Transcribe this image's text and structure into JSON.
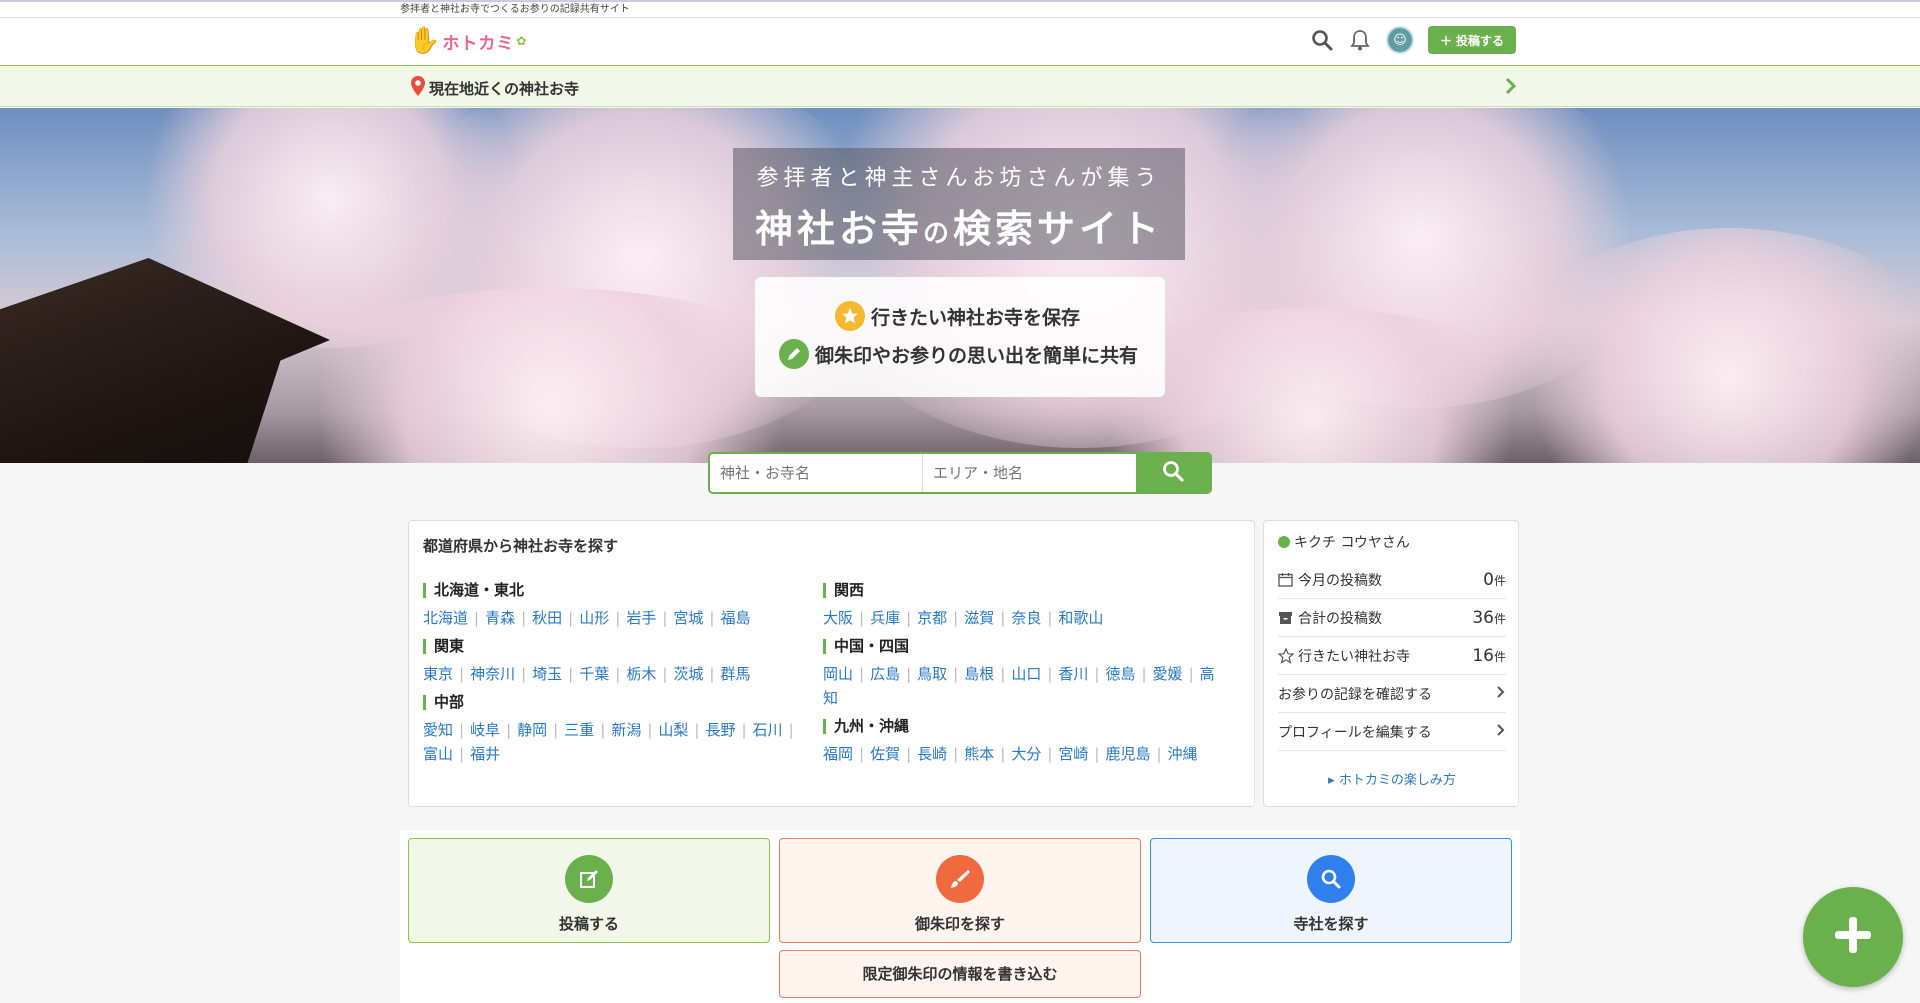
{
  "site": {
    "tagline_strip": "参拝者と神社お寺でつくるお参りの記録共有サイト",
    "logo_text": "ホトカミ"
  },
  "header": {
    "post_label": "投稿する"
  },
  "nearby": {
    "label": "現在地近くの神社お寺"
  },
  "hero": {
    "subtitle": "参拝者と神主さんお坊さんが集う",
    "title_a": "神社お寺",
    "title_no": "の",
    "title_b": "検索サイト",
    "feature1": "行きたい神社お寺を保存",
    "feature2": "御朱印やお参りの思い出を簡単に共有"
  },
  "search": {
    "name_placeholder": "神社・お寺名",
    "area_placeholder": "エリア・地名"
  },
  "prefectures": {
    "title": "都道府県から神社お寺を探す",
    "regions": [
      {
        "name": "北海道・東北",
        "items": [
          "北海道",
          "青森",
          "秋田",
          "山形",
          "岩手",
          "宮城",
          "福島"
        ]
      },
      {
        "name": "関東",
        "items": [
          "東京",
          "神奈川",
          "埼玉",
          "千葉",
          "栃木",
          "茨城",
          "群馬"
        ]
      },
      {
        "name": "中部",
        "items": [
          "愛知",
          "岐阜",
          "静岡",
          "三重",
          "新潟",
          "山梨",
          "長野",
          "石川",
          "富山",
          "福井"
        ]
      },
      {
        "name": "関西",
        "items": [
          "大阪",
          "兵庫",
          "京都",
          "滋賀",
          "奈良",
          "和歌山"
        ]
      },
      {
        "name": "中国・四国",
        "items": [
          "岡山",
          "広島",
          "鳥取",
          "島根",
          "山口",
          "香川",
          "徳島",
          "愛媛",
          "高知"
        ]
      },
      {
        "name": "九州・沖縄",
        "items": [
          "福岡",
          "佐賀",
          "長崎",
          "熊本",
          "大分",
          "宮崎",
          "鹿児島",
          "沖縄"
        ]
      }
    ]
  },
  "user": {
    "name": "キクチ コウヤさん",
    "month_posts_label": "今月の投稿数",
    "month_posts_value": "0",
    "total_posts_label": "合計の投稿数",
    "total_posts_value": "36",
    "wish_label": "行きたい神社お寺",
    "wish_value": "16",
    "unit": "件",
    "records_link": "お参りの記録を確認する",
    "profile_link": "プロフィールを編集する",
    "howto_link": "ホトカミの楽しみ方"
  },
  "actions": {
    "post": "投稿する",
    "goshuin": "御朱印を探す",
    "temple": "寺社を探す",
    "limited": "限定御朱印の情報を書き込む"
  },
  "colors": {
    "brand_green": "#6ab04c",
    "link_blue": "#2a79c4",
    "orange": "#f07d5f",
    "blue": "#3a8ee6"
  }
}
